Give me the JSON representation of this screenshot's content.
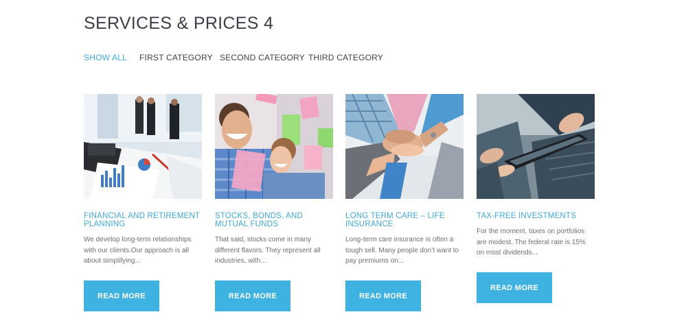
{
  "page": {
    "title": "SERVICES & PRICES 4"
  },
  "filters": [
    {
      "label": "SHOW ALL",
      "active": true
    },
    {
      "label": "FIRST CATEGORY",
      "active": false
    },
    {
      "label": "SECOND CATEGORY",
      "active": false
    },
    {
      "label": "THIRD CATEGORY",
      "active": false
    }
  ],
  "cards": [
    {
      "image_icon": "business-meeting-photo",
      "title": "FINANCIAL AND RETIREMENT PLANNING",
      "description": "We develop long-term relationships with our clients.Our approach is all about simplifying...",
      "button": "READ MORE"
    },
    {
      "image_icon": "smiling-couple-photo",
      "title": "STOCKS, BONDS, AND MUTUAL FUNDS",
      "description": "That said, stocks come in many different flavors. They represent all industries, with...",
      "button": "READ MORE"
    },
    {
      "image_icon": "team-hands-photo",
      "title": "LONG TERM CARE – LIFE INSURANCE",
      "description": "Long-term care insurance is often a tough sell. Many people don’t want to pay premiums on...",
      "button": "READ MORE"
    },
    {
      "image_icon": "tablet-hands-photo",
      "title": "TAX-FREE INVESTMENTS",
      "description": "For the moment, taxes on portfolios are modest. The federal rate is 15% on most dividends...",
      "button": "READ MORE"
    }
  ],
  "colors": {
    "accent": "#3fa9dd",
    "button": "#3eb2e0",
    "heading": "#3a3f47",
    "text": "#6b6f74"
  }
}
